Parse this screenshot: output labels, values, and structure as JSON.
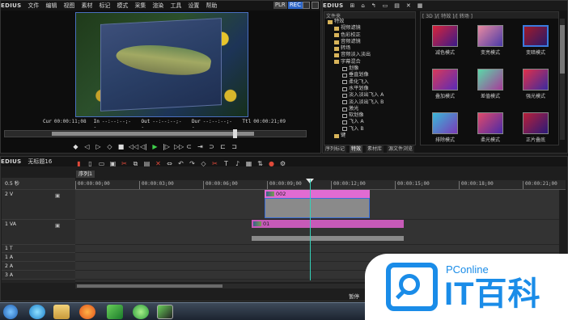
{
  "player": {
    "app": "EDIUS",
    "menu": [
      "文件",
      "编辑",
      "视图",
      "素材",
      "标记",
      "模式",
      "采集",
      "渲染",
      "工具",
      "设置",
      "帮助"
    ],
    "badge_plr": "PLR",
    "badge_rec": "REC",
    "timecodes": [
      {
        "label": "Cur",
        "value": "00:00:11;08"
      },
      {
        "label": "In",
        "value": "--:--:--;--"
      },
      {
        "label": "Out",
        "value": "--:--:--;--"
      },
      {
        "label": "Dur",
        "value": "--:--:--;--"
      },
      {
        "label": "Ttl",
        "value": "00:00:21;09"
      }
    ],
    "transport": [
      "◆",
      "◁",
      "▷",
      "◇",
      "■",
      "◁◁",
      "◁|",
      "▶",
      "|▷",
      "▷▷",
      "⊂",
      "⇥",
      "⊃",
      "⊏",
      "⊐"
    ]
  },
  "effects": {
    "app": "EDIUS",
    "tree_header": "文件夹",
    "grid_header": "[ 3D ]/[ 特效 ]/[ 转场 ]",
    "tree": [
      {
        "label": "特效",
        "type": "folder"
      },
      {
        "label": "视频滤镜",
        "type": "folder"
      },
      {
        "label": "色彩校正",
        "type": "folder"
      },
      {
        "label": "音频滤镜",
        "type": "folder"
      },
      {
        "label": "转场",
        "type": "folder"
      },
      {
        "label": "音频淡入淡出",
        "type": "folder"
      },
      {
        "label": "字幕混合",
        "type": "folder"
      },
      {
        "label": "划像",
        "type": "fx"
      },
      {
        "label": "垂直划像",
        "type": "fx"
      },
      {
        "label": "柔化飞入",
        "type": "fx"
      },
      {
        "label": "水平划像",
        "type": "fx"
      },
      {
        "label": "淡入淡出飞入 A",
        "type": "fx"
      },
      {
        "label": "淡入淡出飞入 B",
        "type": "fx"
      },
      {
        "label": "激光",
        "type": "fx"
      },
      {
        "label": "软划像",
        "type": "fx"
      },
      {
        "label": "飞入 A",
        "type": "fx"
      },
      {
        "label": "飞入 B",
        "type": "fx"
      },
      {
        "label": "键",
        "type": "folder"
      }
    ],
    "grid": [
      {
        "label": "减色模式",
        "colors": [
          "#d8243a",
          "#3a1a8a"
        ]
      },
      {
        "label": "变亮模式",
        "colors": [
          "#e88aa0",
          "#4a3aa8"
        ]
      },
      {
        "label": "变暗模式",
        "colors": [
          "#a01a2a",
          "#2a1a6a"
        ],
        "selected": true
      },
      {
        "label": "叠加模式",
        "colors": [
          "#d83a5a",
          "#5a2ab8"
        ]
      },
      {
        "label": "差值模式",
        "colors": [
          "#5ad8a8",
          "#a83a9a"
        ]
      },
      {
        "label": "强光模式",
        "colors": [
          "#e0304a",
          "#3a2aa0"
        ]
      },
      {
        "label": "排除模式",
        "colors": [
          "#3ab8d8",
          "#7a3ab8"
        ]
      },
      {
        "label": "柔光模式",
        "colors": [
          "#e04a6a",
          "#4a2aa8"
        ]
      },
      {
        "label": "正片叠底",
        "colors": [
          "#b82038",
          "#2a1a7a"
        ]
      }
    ],
    "tabs": [
      "序列标记",
      "特效",
      "素材库",
      "源文件浏览"
    ],
    "active_tab": "特效"
  },
  "timeline": {
    "app": "EDIUS",
    "project": "无标题16",
    "sequence_tab": "序列1",
    "zoom": "0.5 秒",
    "ruler": [
      "00:00:00;00",
      "00:00:03;00",
      "00:00:06;00",
      "00:00:09;00",
      "00:00:12;00",
      "00:00:15;00",
      "00:00:18;00",
      "00:00:21;00"
    ],
    "tracks": [
      {
        "label": "2 V",
        "kind": "video"
      },
      {
        "label": "1 VA",
        "kind": "va"
      },
      {
        "label": "1 T",
        "kind": "title"
      },
      {
        "label": "1 A",
        "kind": "audio"
      },
      {
        "label": "2 A",
        "kind": "audio"
      },
      {
        "label": "3 A",
        "kind": "audio"
      }
    ],
    "clips": [
      {
        "name": "002",
        "color": "#e16bd2"
      },
      {
        "name": "01",
        "color": "#c75ab8"
      }
    ],
    "status": "暂停"
  },
  "watermark": {
    "pconline": "PConline",
    "brand": "IT百科"
  }
}
